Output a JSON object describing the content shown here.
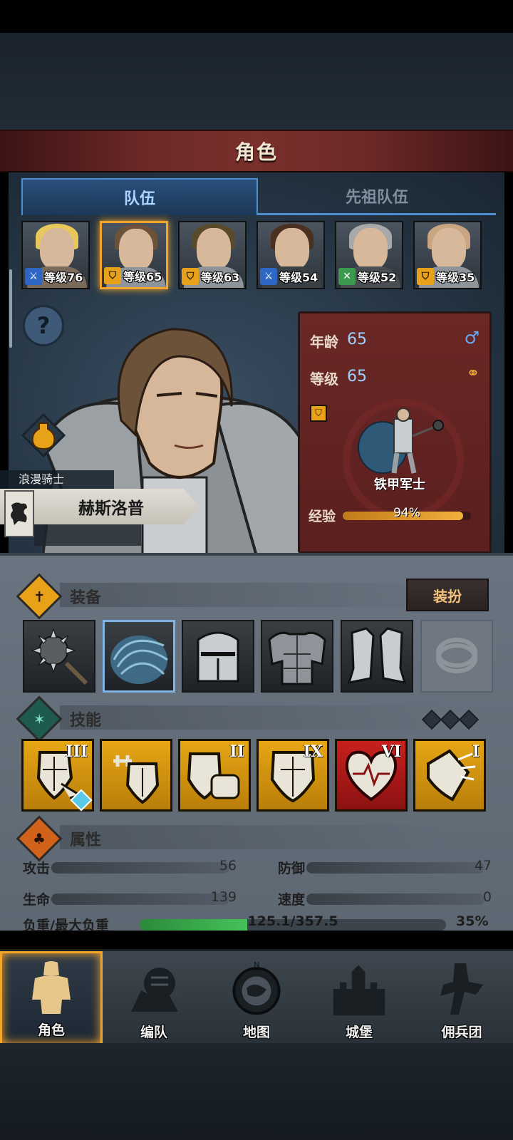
{
  "header": {
    "title": "角色"
  },
  "tabs": [
    {
      "label": "队伍",
      "active": true
    },
    {
      "label": "先祖队伍",
      "active": false
    }
  ],
  "roster": [
    {
      "level_text": "等级76",
      "class": "sword",
      "hair": "#e8c85a"
    },
    {
      "level_text": "等级65",
      "class": "shield",
      "hair": "#6b5238",
      "selected": true
    },
    {
      "level_text": "等级63",
      "class": "shield",
      "hair": "#5a4a2c"
    },
    {
      "level_text": "等级54",
      "class": "sword",
      "hair": "#4a3020"
    },
    {
      "level_text": "等级52",
      "class": "bow",
      "hair": "#a9a9a9"
    },
    {
      "level_text": "等级35",
      "class": "shield",
      "hair": "#c9a582"
    }
  ],
  "hero": {
    "class_title": "浪漫骑士",
    "name": "赫斯洛普"
  },
  "info": {
    "age_label": "年龄",
    "age_value": "65",
    "level_label": "等级",
    "level_value": "65",
    "unit_name": "铁甲军士",
    "exp_label": "经验",
    "exp_value": "94%",
    "exp_fraction": 0.94
  },
  "equipment": {
    "title": "装备",
    "outfit_label": "装扮",
    "slots": [
      "mace-icon",
      "blue-plume-icon",
      "helmet-icon",
      "armor-icon",
      "boots-icon",
      "ring-icon"
    ]
  },
  "skills": {
    "title": "技能",
    "items": [
      {
        "name": "shield-bash-icon",
        "rank": "III",
        "badge": "1"
      },
      {
        "name": "shield-strength-icon",
        "rank": ""
      },
      {
        "name": "shield-fist-icon",
        "rank": "II"
      },
      {
        "name": "shield-icon",
        "rank": "IX"
      },
      {
        "name": "heart-icon",
        "rank": "VI",
        "color": "red"
      },
      {
        "name": "shield-break-icon",
        "rank": "I"
      }
    ]
  },
  "attributes": {
    "title": "属性",
    "attack_label": "攻击",
    "attack_value": "56",
    "defense_label": "防御",
    "defense_value": "47",
    "hp_label": "生命",
    "hp_value": "139",
    "speed_label": "速度",
    "speed_value": "0",
    "load_label": "负重/最大负重",
    "load_value": "125.1/357.5",
    "load_percent": "35%",
    "load_fraction": 0.35
  },
  "nav": [
    {
      "label": "角色",
      "icon": "knight-icon",
      "active": true
    },
    {
      "label": "编队",
      "icon": "formation-icon"
    },
    {
      "label": "地图",
      "icon": "compass-map-icon"
    },
    {
      "label": "城堡",
      "icon": "castle-icon"
    },
    {
      "label": "佣兵团",
      "icon": "mercenary-icon"
    }
  ],
  "colors": {
    "accent": "#f3a52b",
    "tab_active": "#4d8fd1",
    "exp": "#f0b03c",
    "load": "#46c25a"
  }
}
